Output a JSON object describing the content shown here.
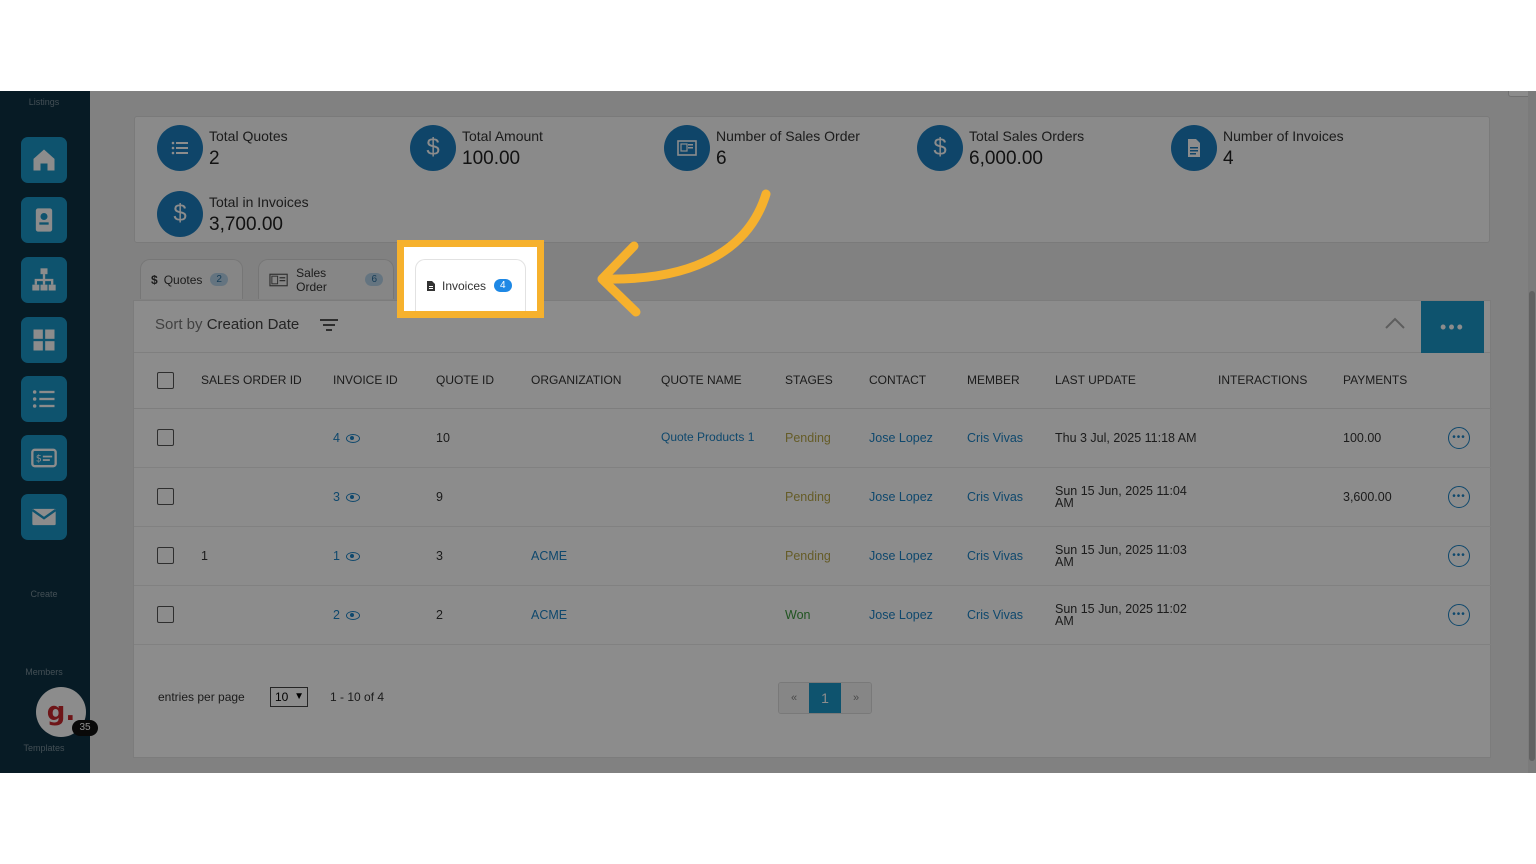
{
  "sidebar": {
    "listings_label": "Listings",
    "create_label": "Create",
    "members_label": "Members",
    "templates_label": "Templates",
    "avatar_letter": "g.",
    "avatar_badge": "35",
    "buttons": [
      "home-icon",
      "contact-card-icon",
      "org-chart-icon",
      "grid-icon",
      "list-icon",
      "invoice-card-icon",
      "mail-icon"
    ]
  },
  "summary": {
    "total_quotes_label": "Total Quotes",
    "total_quotes_value": "2",
    "total_amount_label": "Total Amount",
    "total_amount_value": "100.00",
    "num_sales_order_label": "Number of Sales Order",
    "num_sales_order_value": "6",
    "total_sales_orders_label": "Total Sales Orders",
    "total_sales_orders_value": "6,000.00",
    "num_invoices_label": "Number of Invoices",
    "num_invoices_value": "4",
    "total_in_invoices_label": "Total in Invoices",
    "total_in_invoices_value": "3,700.00"
  },
  "tabs": [
    {
      "label": "Quotes",
      "count": "2",
      "icon": "$"
    },
    {
      "label": "Sales Order",
      "count": "6"
    },
    {
      "label": "Invoices",
      "count": "4"
    }
  ],
  "sort": {
    "prefix": "Sort by",
    "field": "Creation Date"
  },
  "table": {
    "headers": [
      "SALES ORDER ID",
      "INVOICE ID",
      "QUOTE ID",
      "ORGANIZATION",
      "QUOTE NAME",
      "STAGES",
      "CONTACT",
      "MEMBER",
      "LAST UPDATE",
      "INTERACTIONS",
      "PAYMENTS"
    ],
    "rows": [
      {
        "sales_order_id": "",
        "invoice_id": "4",
        "quote_id": "10",
        "organization": "",
        "quote_name": "Quote Products 1",
        "stage": "Pending",
        "contact": "Jose Lopez",
        "member": "Cris Vivas",
        "last_update": "Thu 3 Jul, 2025 11:18 AM",
        "interactions": "",
        "payments": "100.00"
      },
      {
        "sales_order_id": "",
        "invoice_id": "3",
        "quote_id": "9",
        "organization": "",
        "quote_name": "",
        "stage": "Pending",
        "contact": "Jose Lopez",
        "member": "Cris Vivas",
        "last_update": "Sun 15 Jun, 2025 11:04 AM",
        "interactions": "",
        "payments": "3,600.00"
      },
      {
        "sales_order_id": "1",
        "invoice_id": "1",
        "quote_id": "3",
        "organization": "ACME",
        "quote_name": "",
        "stage": "Pending",
        "contact": "Jose Lopez",
        "member": "Cris Vivas",
        "last_update": "Sun 15 Jun, 2025 11:03 AM",
        "interactions": "",
        "payments": ""
      },
      {
        "sales_order_id": "",
        "invoice_id": "2",
        "quote_id": "2",
        "organization": "ACME",
        "quote_name": "",
        "stage": "Won",
        "contact": "Jose Lopez",
        "member": "Cris Vivas",
        "last_update": "Sun 15 Jun, 2025 11:02 AM",
        "interactions": "",
        "payments": ""
      }
    ]
  },
  "footer": {
    "entries_label": "entries per page",
    "entries_value": "10",
    "range": "1 - 10 of 4",
    "prev": "«",
    "current_page": "1",
    "next": "»"
  },
  "colors": {
    "accent": "#1a98c9",
    "sidebar": "#0d3244",
    "highlight": "#f6b12d",
    "pending": "#b9a84a",
    "won": "#3c9a3c"
  }
}
